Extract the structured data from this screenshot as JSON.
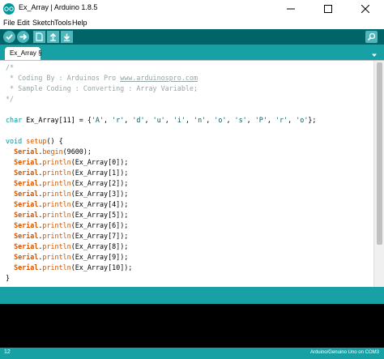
{
  "window": {
    "title": "Ex_Array | Arduino 1.8.5"
  },
  "menu": {
    "items": [
      "File",
      "Edit",
      "Sketch",
      "Tools",
      "Help"
    ]
  },
  "toolbar": {
    "buttons": [
      "verify-icon",
      "upload-icon",
      "new-icon",
      "open-icon",
      "save-icon"
    ],
    "serial_monitor_icon": "magnifier-icon"
  },
  "tabs": [
    {
      "label": "Ex_Array §",
      "active": true
    }
  ],
  "editor": {
    "comment_lines": [
      "/*",
      " * Coding By : Arduinos Pro ",
      " * Sample Coding : Converting : Array Variable;",
      "*/"
    ],
    "comment_link": "www.arduinospro.com",
    "array_decl_type": "char",
    "array_decl_rest": " Ex_Array[11] = {",
    "array_items": [
      "'A'",
      "'r'",
      "'d'",
      "'u'",
      "'i'",
      "'n'",
      "'o'",
      "'s'",
      "'P'",
      "'r'",
      "'o'"
    ],
    "array_close": "};",
    "setup_type": "void",
    "setup_fn": "setup",
    "setup_open": "() {",
    "serial_obj": "Serial",
    "begin_fn": "begin",
    "begin_args": "(9600);",
    "println_fn": "println",
    "println_args": [
      "(Ex_Array[0]);",
      "(Ex_Array[1]);",
      "(Ex_Array[2]);",
      "(Ex_Array[3]);",
      "(Ex_Array[4]);",
      "(Ex_Array[5]);",
      "(Ex_Array[6]);",
      "(Ex_Array[7]);",
      "(Ex_Array[8]);",
      "(Ex_Array[9]);",
      "(Ex_Array[10]);"
    ],
    "closing_brace": "}"
  },
  "footer": {
    "line_number": "12",
    "board": "Arduino/Genuino Uno on COM3"
  },
  "colors": {
    "toolbar": "#006468",
    "tabbar": "#17a1a5",
    "comment": "#95a5a6",
    "keyword": "#00979c",
    "function": "#d35400"
  }
}
